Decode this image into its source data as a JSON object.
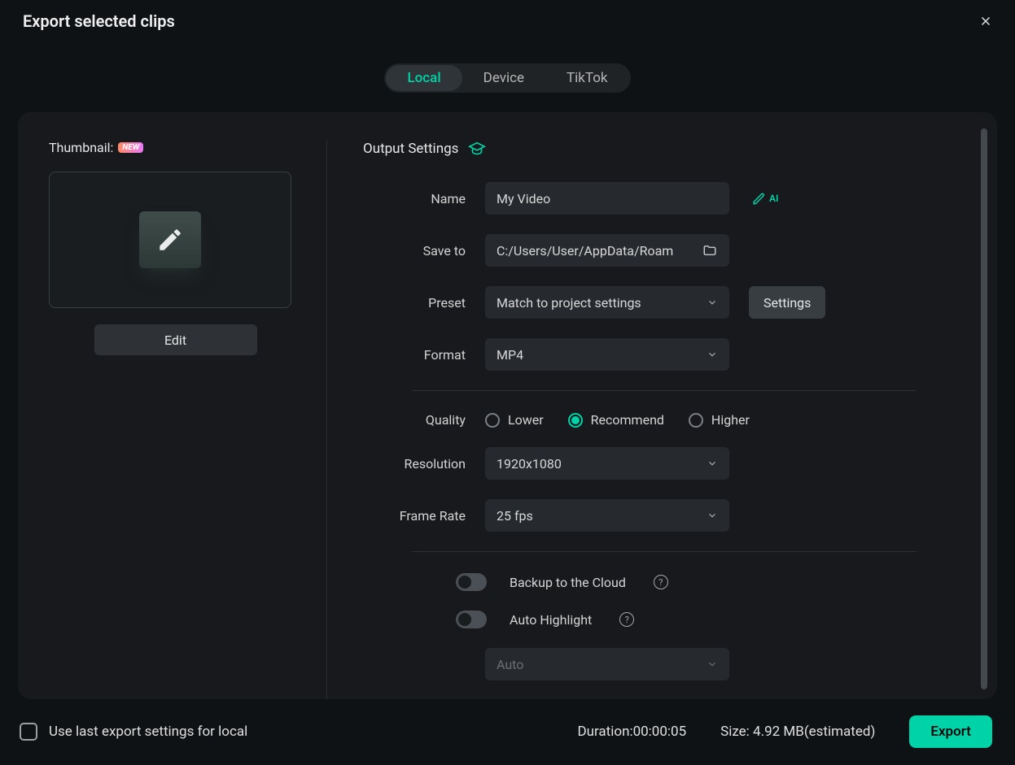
{
  "header": {
    "title": "Export selected clips"
  },
  "tabs": [
    {
      "label": "Local",
      "active": true
    },
    {
      "label": "Device",
      "active": false
    },
    {
      "label": "TikTok",
      "active": false
    }
  ],
  "thumbnail": {
    "label": "Thumbnail:",
    "badge": "NEW",
    "edit": "Edit"
  },
  "output": {
    "section_label": "Output Settings",
    "name_label": "Name",
    "name_value": "My Video",
    "ai_label": "AI",
    "saveto_label": "Save to",
    "saveto_value": "C:/Users/User/AppData/Roam",
    "preset_label": "Preset",
    "preset_value": "Match to project settings",
    "settings_btn": "Settings",
    "format_label": "Format",
    "format_value": "MP4",
    "quality_label": "Quality",
    "quality_options": {
      "lower": "Lower",
      "recommend": "Recommend",
      "higher": "Higher"
    },
    "resolution_label": "Resolution",
    "resolution_value": "1920x1080",
    "framerate_label": "Frame Rate",
    "framerate_value": "25 fps",
    "backup_label": "Backup to the Cloud",
    "autohighlight_label": "Auto Highlight",
    "auto_value": "Auto"
  },
  "footer": {
    "checkbox_label": "Use last export settings for local",
    "duration_label": "Duration:",
    "duration_value": "00:00:05",
    "size_label": "Size: ",
    "size_value": "4.92 MB",
    "size_suffix": "(estimated)",
    "export_btn": "Export"
  }
}
